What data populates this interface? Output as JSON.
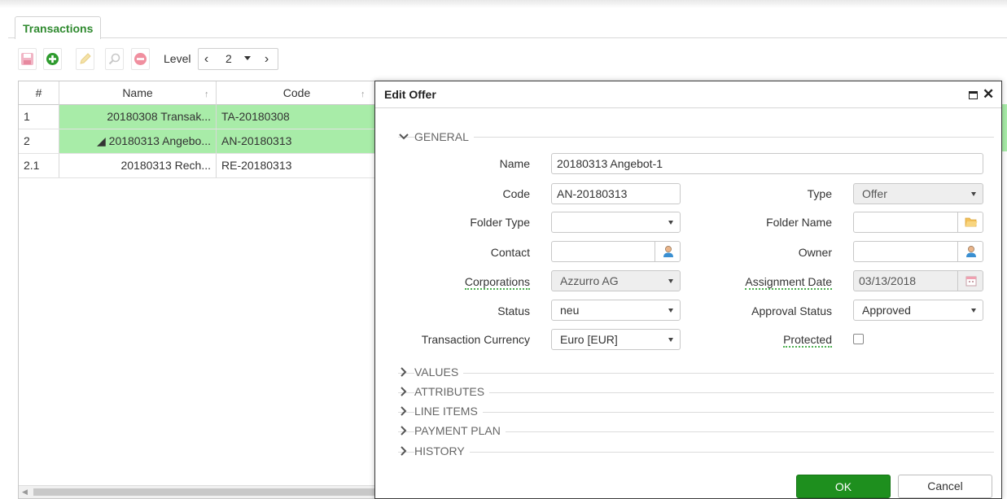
{
  "tabs": [
    {
      "label": "Transactions",
      "active": true
    }
  ],
  "toolbar": {
    "level_label": "Level",
    "level_value": "2"
  },
  "grid": {
    "columns": [
      {
        "label": "#"
      },
      {
        "label": "Name"
      },
      {
        "label": "Code"
      }
    ],
    "rows": [
      {
        "num": "1",
        "name": "20180308 Transak...",
        "code": "TA-20180308",
        "highlight": true
      },
      {
        "num": "2",
        "name": "◢ 20180313 Angebo...",
        "code": "AN-20180313",
        "highlight": true
      },
      {
        "num": "2.1",
        "name": "20180313 Rech...",
        "code": "RE-20180313",
        "highlight": false
      }
    ]
  },
  "dialog": {
    "title": "Edit Offer",
    "sections": {
      "general": "GENERAL",
      "values": "VALUES",
      "attributes": "ATTRIBUTES",
      "line_items": "LINE ITEMS",
      "payment_plan": "PAYMENT PLAN",
      "history": "HISTORY"
    },
    "fields": {
      "name": {
        "label": "Name",
        "value": "20180313 Angebot-1"
      },
      "code": {
        "label": "Code",
        "value": "AN-20180313"
      },
      "type": {
        "label": "Type",
        "value": "Offer"
      },
      "folder_type": {
        "label": "Folder Type",
        "value": ""
      },
      "folder_name": {
        "label": "Folder Name",
        "value": ""
      },
      "contact": {
        "label": "Contact",
        "value": ""
      },
      "owner": {
        "label": "Owner",
        "value": ""
      },
      "corporations": {
        "label": "Corporations",
        "value": "Azzurro AG"
      },
      "assignment_date": {
        "label": "Assignment Date",
        "value": "03/13/2018"
      },
      "status": {
        "label": "Status",
        "value": "neu"
      },
      "approval_status": {
        "label": "Approval Status",
        "value": "Approved"
      },
      "transaction_currency": {
        "label": "Transaction Currency",
        "value": "Euro [EUR]"
      },
      "protected": {
        "label": "Protected",
        "checked": false
      }
    },
    "buttons": {
      "ok": "OK",
      "cancel": "Cancel"
    }
  },
  "colors": {
    "accent_green": "#1e8f1e",
    "row_highlight": "#a8eca8",
    "tab_text": "#2f8a2f"
  },
  "icons": {
    "toolbar": [
      "save-icon",
      "add-icon",
      "edit-icon",
      "search-icon",
      "delete-icon"
    ],
    "fields": [
      "folder-icon",
      "user-icon",
      "calendar-icon"
    ]
  }
}
